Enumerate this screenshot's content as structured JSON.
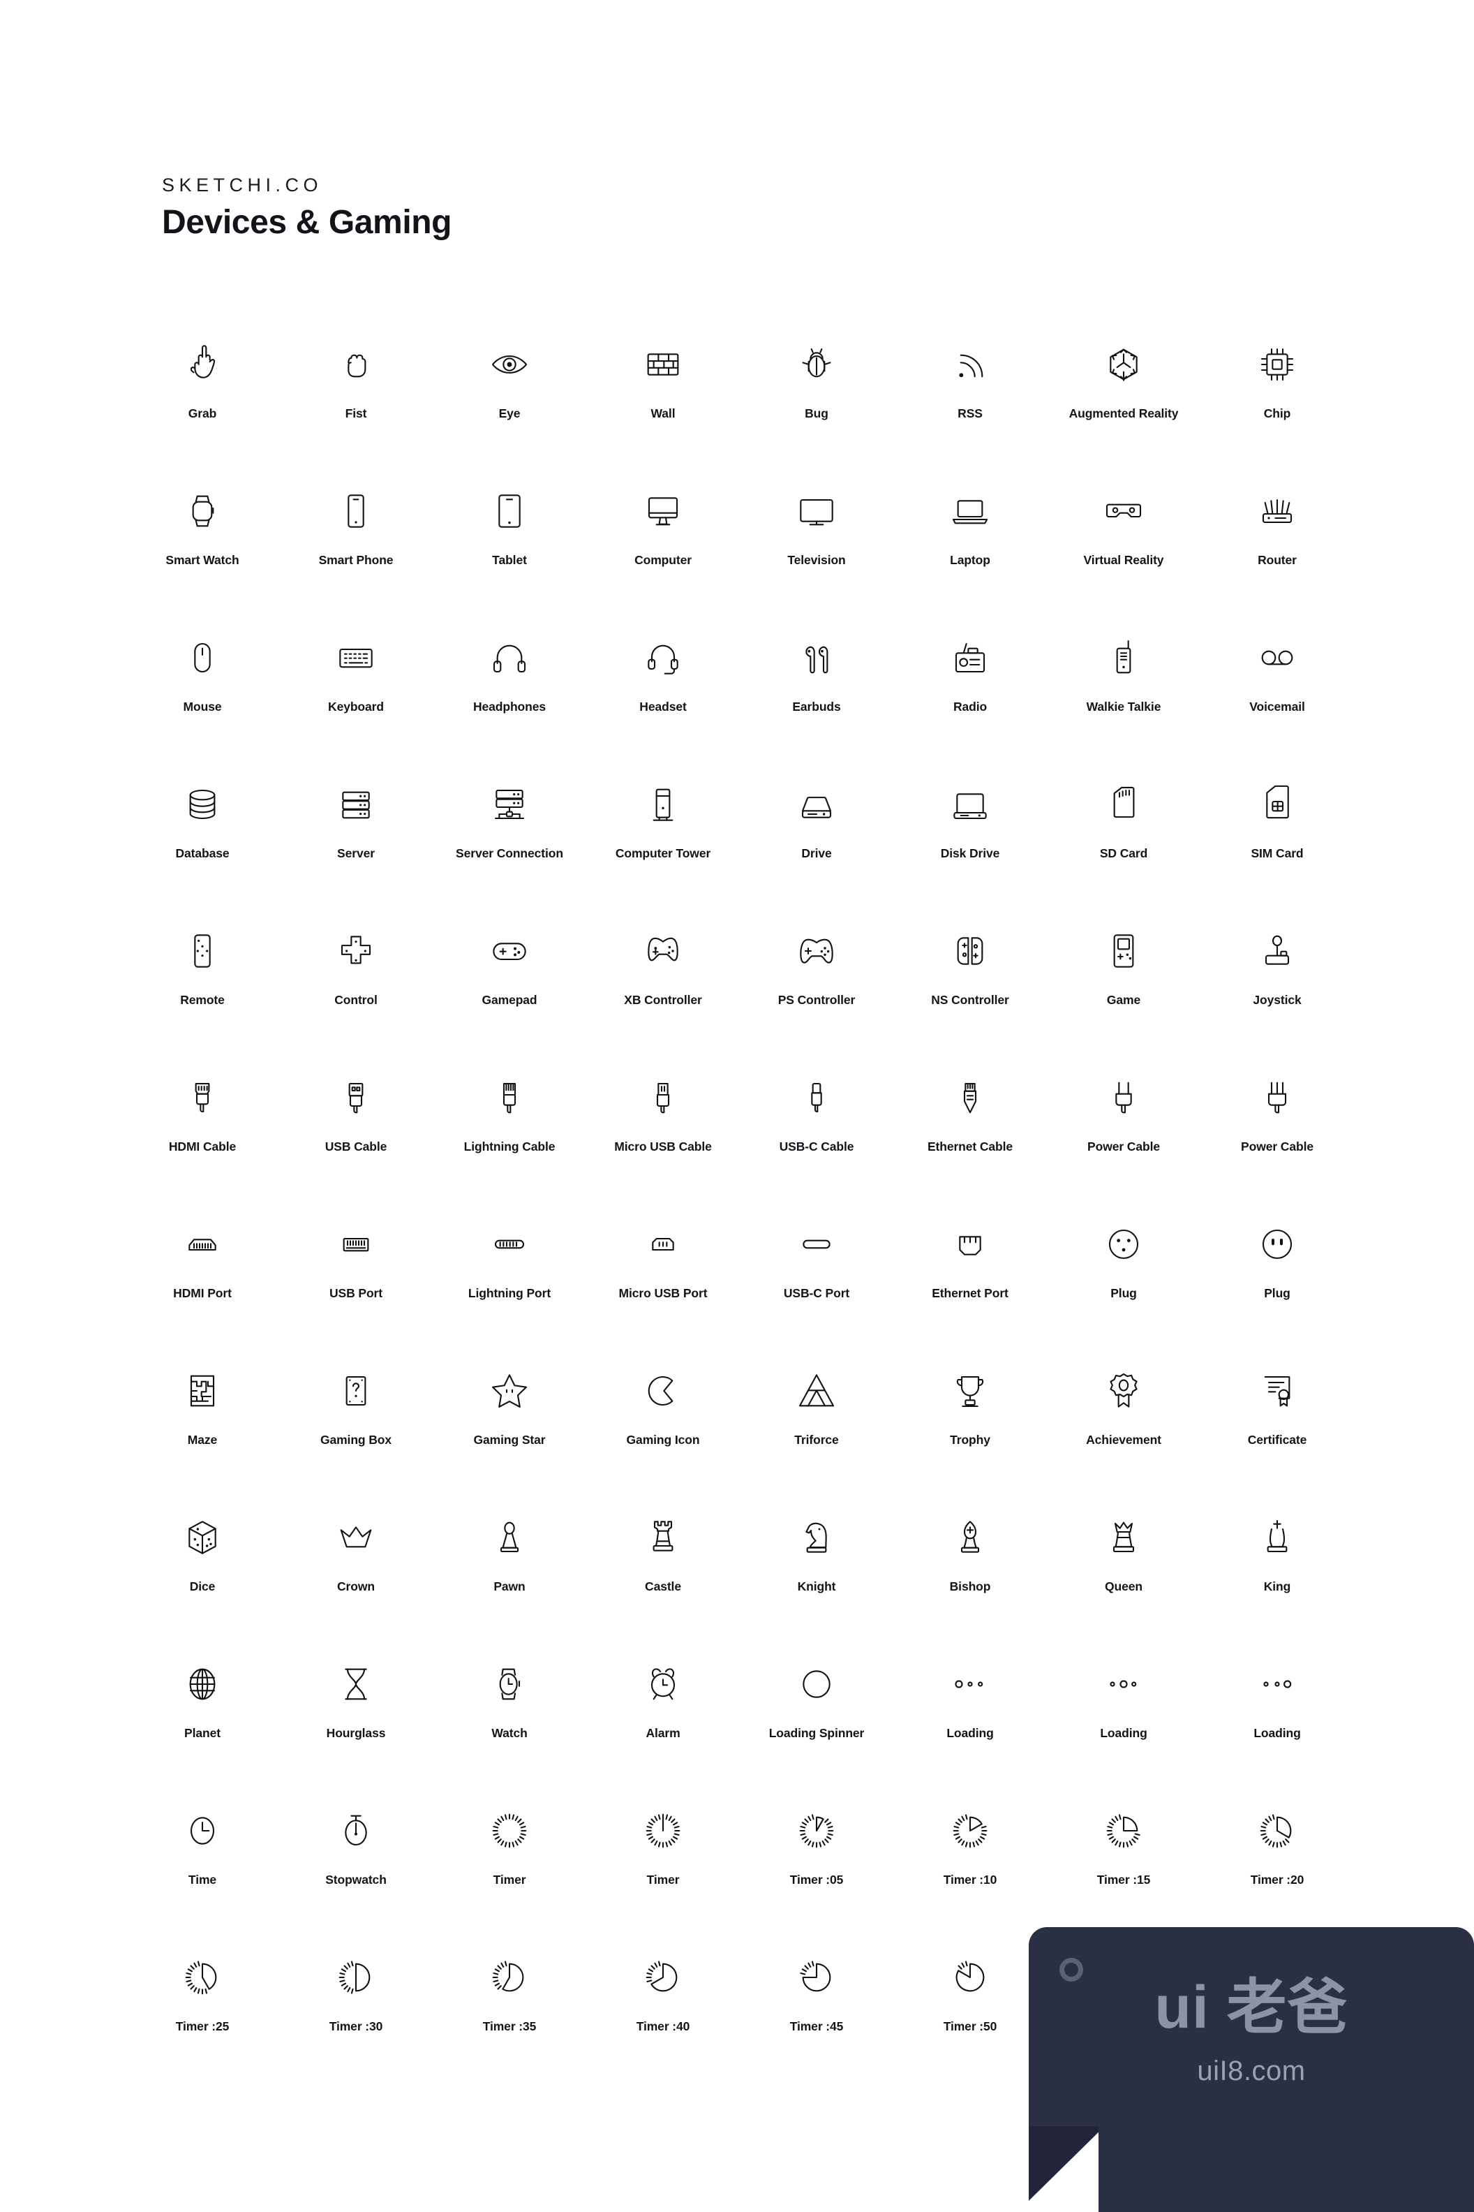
{
  "header": {
    "brand": "SKETCHI.CO",
    "title": "Devices & Gaming"
  },
  "colors": {
    "background": "#ffffff",
    "icon_stroke": "#111216",
    "label_text": "#14151a",
    "watermark_card": "#2b2f44",
    "watermark_text": "#8d92a6"
  },
  "watermark": {
    "main": "ui 老爸",
    "sub": "uiI8.com",
    "dot_icon": "circle-outline-icon"
  },
  "grid": {
    "columns": 8,
    "rows": 12,
    "total_icons": 94
  },
  "icons": [
    {
      "label": "Grab",
      "icon": "grab-hand-icon"
    },
    {
      "label": "Fist",
      "icon": "fist-icon"
    },
    {
      "label": "Eye",
      "icon": "eye-icon"
    },
    {
      "label": "Wall",
      "icon": "wall-icon"
    },
    {
      "label": "Bug",
      "icon": "bug-icon"
    },
    {
      "label": "RSS",
      "icon": "rss-icon"
    },
    {
      "label": "Augmented Reality",
      "icon": "augmented-reality-icon"
    },
    {
      "label": "Chip",
      "icon": "chip-icon"
    },
    {
      "label": "Smart Watch",
      "icon": "smart-watch-icon"
    },
    {
      "label": "Smart Phone",
      "icon": "smart-phone-icon"
    },
    {
      "label": "Tablet",
      "icon": "tablet-icon"
    },
    {
      "label": "Computer",
      "icon": "computer-icon"
    },
    {
      "label": "Television",
      "icon": "television-icon"
    },
    {
      "label": "Laptop",
      "icon": "laptop-icon"
    },
    {
      "label": "Virtual Reality",
      "icon": "virtual-reality-icon"
    },
    {
      "label": "Router",
      "icon": "router-icon"
    },
    {
      "label": "Mouse",
      "icon": "mouse-icon"
    },
    {
      "label": "Keyboard",
      "icon": "keyboard-icon"
    },
    {
      "label": "Headphones",
      "icon": "headphones-icon"
    },
    {
      "label": "Headset",
      "icon": "headset-icon"
    },
    {
      "label": "Earbuds",
      "icon": "earbuds-icon"
    },
    {
      "label": "Radio",
      "icon": "radio-icon"
    },
    {
      "label": "Walkie Talkie",
      "icon": "walkie-talkie-icon"
    },
    {
      "label": "Voicemail",
      "icon": "voicemail-icon"
    },
    {
      "label": "Database",
      "icon": "database-icon"
    },
    {
      "label": "Server",
      "icon": "server-icon"
    },
    {
      "label": "Server Connection",
      "icon": "server-connection-icon"
    },
    {
      "label": "Computer Tower",
      "icon": "computer-tower-icon"
    },
    {
      "label": "Drive",
      "icon": "drive-icon"
    },
    {
      "label": "Disk Drive",
      "icon": "disk-drive-icon"
    },
    {
      "label": "SD Card",
      "icon": "sd-card-icon"
    },
    {
      "label": "SIM Card",
      "icon": "sim-card-icon"
    },
    {
      "label": "Remote",
      "icon": "remote-icon"
    },
    {
      "label": "Control",
      "icon": "control-dpad-icon"
    },
    {
      "label": "Gamepad",
      "icon": "gamepad-icon"
    },
    {
      "label": "XB Controller",
      "icon": "xb-controller-icon"
    },
    {
      "label": "PS Controller",
      "icon": "ps-controller-icon"
    },
    {
      "label": "NS Controller",
      "icon": "ns-controller-icon"
    },
    {
      "label": "Game",
      "icon": "handheld-game-icon"
    },
    {
      "label": "Joystick",
      "icon": "joystick-icon"
    },
    {
      "label": "HDMI Cable",
      "icon": "hdmi-cable-icon"
    },
    {
      "label": "USB Cable",
      "icon": "usb-cable-icon"
    },
    {
      "label": "Lightning Cable",
      "icon": "lightning-cable-icon"
    },
    {
      "label": "Micro USB Cable",
      "icon": "micro-usb-cable-icon"
    },
    {
      "label": "USB-C Cable",
      "icon": "usb-c-cable-icon"
    },
    {
      "label": "Ethernet Cable",
      "icon": "ethernet-cable-icon"
    },
    {
      "label": "Power Cable",
      "icon": "power-cable-two-pin-icon"
    },
    {
      "label": "Power Cable",
      "icon": "power-cable-three-pin-icon"
    },
    {
      "label": "HDMI Port",
      "icon": "hdmi-port-icon"
    },
    {
      "label": "USB Port",
      "icon": "usb-port-icon"
    },
    {
      "label": "Lightning Port",
      "icon": "lightning-port-icon"
    },
    {
      "label": "Micro USB Port",
      "icon": "micro-usb-port-icon"
    },
    {
      "label": "USB-C Port",
      "icon": "usb-c-port-icon"
    },
    {
      "label": "Ethernet Port",
      "icon": "ethernet-port-icon"
    },
    {
      "label": "Plug",
      "icon": "plug-three-prong-icon"
    },
    {
      "label": "Plug",
      "icon": "plug-two-prong-icon"
    },
    {
      "label": "Maze",
      "icon": "maze-icon"
    },
    {
      "label": "Gaming Box",
      "icon": "gaming-box-icon"
    },
    {
      "label": "Gaming Star",
      "icon": "gaming-star-icon"
    },
    {
      "label": "Gaming Icon",
      "icon": "pacman-icon"
    },
    {
      "label": "Triforce",
      "icon": "triforce-icon"
    },
    {
      "label": "Trophy",
      "icon": "trophy-icon"
    },
    {
      "label": "Achievement",
      "icon": "achievement-medal-icon"
    },
    {
      "label": "Certificate",
      "icon": "certificate-icon"
    },
    {
      "label": "Dice",
      "icon": "dice-icon"
    },
    {
      "label": "Crown",
      "icon": "crown-icon"
    },
    {
      "label": "Pawn",
      "icon": "chess-pawn-icon"
    },
    {
      "label": "Castle",
      "icon": "chess-rook-icon"
    },
    {
      "label": "Knight",
      "icon": "chess-knight-icon"
    },
    {
      "label": "Bishop",
      "icon": "chess-bishop-icon"
    },
    {
      "label": "Queen",
      "icon": "chess-queen-icon"
    },
    {
      "label": "King",
      "icon": "chess-king-icon"
    },
    {
      "label": "Planet",
      "icon": "planet-globe-icon"
    },
    {
      "label": "Hourglass",
      "icon": "hourglass-icon"
    },
    {
      "label": "Watch",
      "icon": "watch-icon"
    },
    {
      "label": "Alarm",
      "icon": "alarm-clock-icon"
    },
    {
      "label": "Loading Spinner",
      "icon": "loading-spinner-icon"
    },
    {
      "label": "Loading",
      "icon": "loading-dots-one-icon"
    },
    {
      "label": "Loading",
      "icon": "loading-dots-two-icon"
    },
    {
      "label": "Loading",
      "icon": "loading-dots-three-icon"
    },
    {
      "label": "Time",
      "icon": "clock-icon"
    },
    {
      "label": "Stopwatch",
      "icon": "stopwatch-icon"
    },
    {
      "label": "Timer",
      "icon": "timer-00-icon"
    },
    {
      "label": "Timer",
      "icon": "timer-60-icon"
    },
    {
      "label": "Timer :05",
      "icon": "timer-05-icon"
    },
    {
      "label": "Timer :10",
      "icon": "timer-10-icon"
    },
    {
      "label": "Timer :15",
      "icon": "timer-15-icon"
    },
    {
      "label": "Timer :20",
      "icon": "timer-20-icon"
    },
    {
      "label": "Timer :25",
      "icon": "timer-25-icon"
    },
    {
      "label": "Timer :30",
      "icon": "timer-30-icon"
    },
    {
      "label": "Timer :35",
      "icon": "timer-35-icon"
    },
    {
      "label": "Timer :40",
      "icon": "timer-40-icon"
    },
    {
      "label": "Timer :45",
      "icon": "timer-45-icon"
    },
    {
      "label": "Timer :50",
      "icon": "timer-50-icon"
    }
  ]
}
